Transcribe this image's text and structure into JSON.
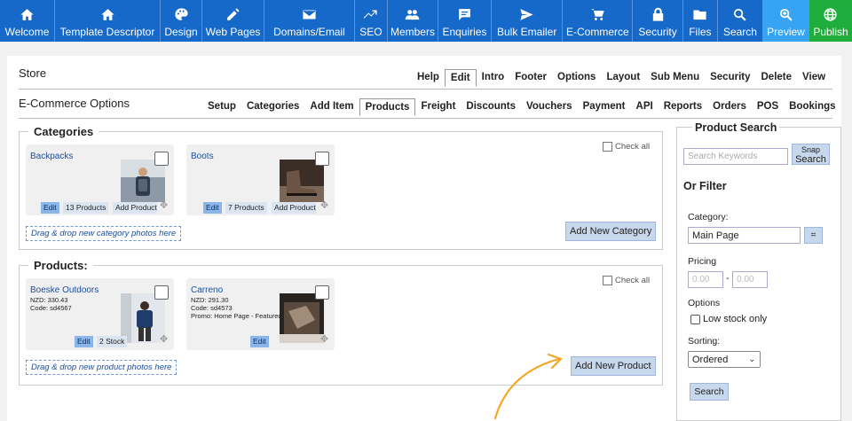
{
  "toolbar": {
    "items": [
      {
        "label": "Welcome",
        "icon": "home-icon"
      },
      {
        "label": "Template Descriptor",
        "icon": "home-icon"
      },
      {
        "label": "Design",
        "icon": "palette-icon"
      },
      {
        "label": "Web Pages",
        "icon": "pencil-icon"
      },
      {
        "label": "Domains/Email",
        "icon": "envelope-icon"
      },
      {
        "label": "SEO",
        "icon": "trend-icon"
      },
      {
        "label": "Members",
        "icon": "people-icon"
      },
      {
        "label": "Enquiries",
        "icon": "chat-icon"
      },
      {
        "label": "Bulk Emailer",
        "icon": "send-icon"
      },
      {
        "label": "E-Commerce",
        "icon": "cart-icon"
      },
      {
        "label": "Security",
        "icon": "lock-icon"
      },
      {
        "label": "Files",
        "icon": "folder-icon"
      },
      {
        "label": "Search",
        "icon": "search-icon"
      },
      {
        "label": "Preview",
        "icon": "zoom-icon"
      },
      {
        "label": "Publish",
        "icon": "globe-icon"
      }
    ],
    "preview_color": "#36a4f3",
    "publish_color": "#1fae3c",
    "bar_color": "#1668c9"
  },
  "store": {
    "title": "Store",
    "menu": [
      "Help",
      "Edit",
      "Intro",
      "Footer",
      "Options",
      "Layout",
      "Sub Menu",
      "Security",
      "Delete",
      "View"
    ],
    "active": "Edit"
  },
  "ecom": {
    "title": "E-Commerce Options",
    "menu": [
      "Setup",
      "Categories",
      "Add Item",
      "Products",
      "Freight",
      "Discounts",
      "Vouchers",
      "Payment",
      "API",
      "Reports",
      "Orders",
      "POS",
      "Bookings"
    ],
    "active": "Products"
  },
  "categories": {
    "legend": "Categories",
    "check_all": "Check all",
    "cards": [
      {
        "name": "Backpacks",
        "edit": "Edit",
        "count": "13 Products",
        "add": "Add Product"
      },
      {
        "name": "Boots",
        "edit": "Edit",
        "count": "7 Products",
        "add": "Add Product"
      }
    ],
    "dropzone": "Drag & drop new category photos here",
    "add_button": "Add New Category"
  },
  "products": {
    "legend": "Products:",
    "check_all": "Check all",
    "cards": [
      {
        "name": "Boeske Outdoors",
        "price": "NZD: 330.43",
        "code": "Code: sd4567",
        "promo": "",
        "edit": "Edit",
        "stock": "2 Stock"
      },
      {
        "name": "Carreno",
        "price": "NZD: 291.30",
        "code": "Code: sd4573",
        "promo": "Promo: Home Page - Featured",
        "edit": "Edit",
        "stock": ""
      }
    ],
    "dropzone": "Drag & drop new product photos here",
    "add_button": "Add New Product"
  },
  "sidebar": {
    "title": "Product Search",
    "search_placeholder": "Search Keywords",
    "snap_label": "Snap",
    "search_btn": "Search",
    "or_filter": "Or Filter",
    "category_label": "Category:",
    "category_value": "Main Page",
    "equals": "=",
    "pricing_label": "Pricing",
    "price_min": "0.00",
    "dash": "-",
    "price_max": "0.00",
    "options_label": "Options",
    "low_stock": "Low stock only",
    "sorting_label": "Sorting:",
    "sorting_value": "Ordered",
    "submit": "Search"
  },
  "annotation": {
    "arrow_color": "#f5a623"
  }
}
